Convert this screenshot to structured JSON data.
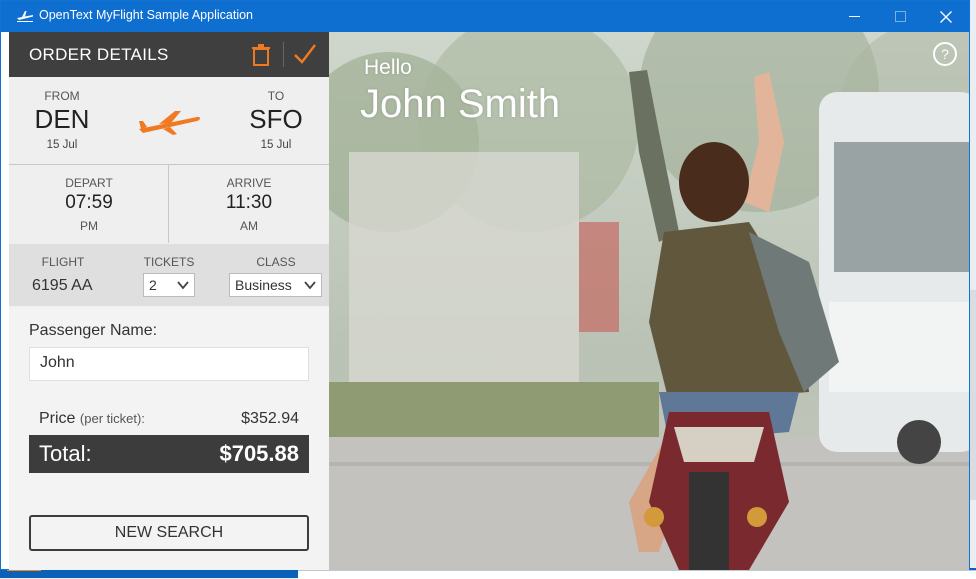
{
  "window": {
    "title": "OpenText MyFlight Sample Application",
    "accent": "#0e6fd1"
  },
  "panel": {
    "header": "ORDER DETAILS",
    "header_icons": [
      "trash-icon",
      "check-icon"
    ],
    "accent": "#f07a24",
    "from": {
      "label": "FROM",
      "code": "DEN",
      "date": "15 Jul"
    },
    "to": {
      "label": "TO",
      "code": "SFO",
      "date": "15 Jul"
    },
    "depart": {
      "label": "DEPART",
      "time": "07:59",
      "ampm": "PM"
    },
    "arrive": {
      "label": "ARRIVE",
      "time": "11:30",
      "ampm": "AM"
    },
    "flight": {
      "label": "FLIGHT",
      "value": "6195 AA"
    },
    "tickets": {
      "label": "TICKETS",
      "value": "2"
    },
    "class": {
      "label": "CLASS",
      "value": "Business"
    },
    "passenger": {
      "label": "Passenger Name:",
      "value": "John"
    },
    "price": {
      "label": "Price",
      "per": "(per ticket):",
      "value": "$352.94"
    },
    "total": {
      "label": "Total:",
      "value": "$705.88"
    },
    "new_search": "NEW SEARCH"
  },
  "greeting": {
    "hello": "Hello",
    "name": "John Smith"
  },
  "help": "?"
}
